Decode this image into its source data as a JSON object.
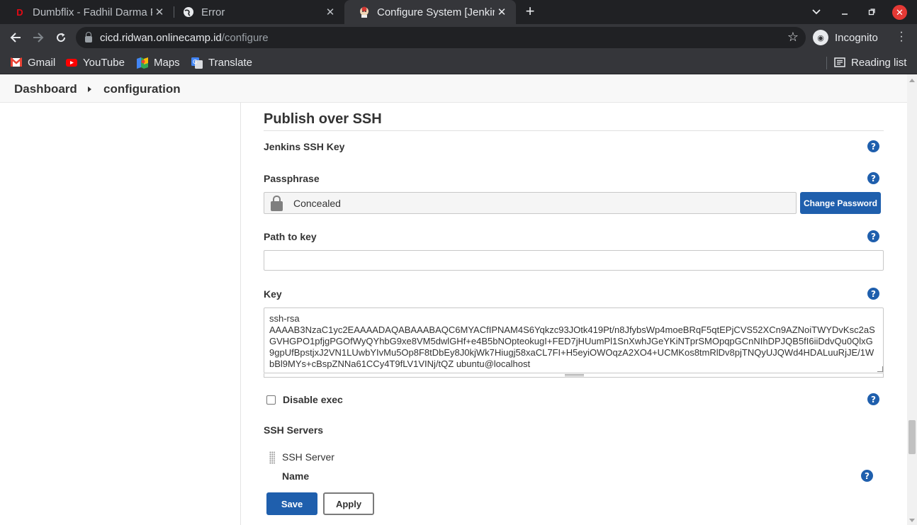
{
  "browser": {
    "tabs": [
      {
        "title": "Dumbflix - Fadhil Darma P",
        "icon": "dumbflix-icon",
        "active": false
      },
      {
        "title": "Error",
        "icon": "globe-icon",
        "active": false
      },
      {
        "title": "Configure System [Jenkins",
        "icon": "jenkins-icon",
        "active": true
      }
    ],
    "new_tab": "+",
    "url_host": "cicd.ridwan.onlinecamp.id",
    "url_path": "/configure",
    "profile_label": "Incognito",
    "bookmarks": [
      {
        "label": "Gmail",
        "icon": "gmail-icon",
        "color": "#ea4335"
      },
      {
        "label": "YouTube",
        "icon": "youtube-icon",
        "color": "#ff0000"
      },
      {
        "label": "Maps",
        "icon": "maps-icon",
        "color": "#34a853"
      },
      {
        "label": "Translate",
        "icon": "translate-icon",
        "color": "#4285f4"
      }
    ],
    "reading_list": "Reading list"
  },
  "breadcrumb": {
    "items": [
      "Dashboard",
      "configuration"
    ]
  },
  "section": {
    "title": "Publish over SSH",
    "jenkins_ssh_key_label": "Jenkins SSH Key",
    "passphrase_label": "Passphrase",
    "passphrase_value": "Concealed",
    "change_password_label": "Change Password",
    "path_to_key_label": "Path to key",
    "path_to_key_value": "",
    "key_label": "Key",
    "key_line1": "ssh-rsa",
    "key_line2": "AAAAB3NzaC1yc2EAAAADAQABAAABAQC6MYACfIPNAM4S6Yqkzc93JOtk419Pt/n8JfybsWp4moeBRqF5qtEPjCVS52XCn9AZNoiTWYDvKsc2aSGVHGPO1pfjgPGOfWyQYhbG9xe8VM5dwlGHf+e4B5bNOpteokugI+FED7jHUumPl1SnXwhJGeYKiNTprSMOpqpGCnNIhDPJQB5fI6iiDdvQu0QlxG9gpUfBpstjxJ2VN1LUwbYIvMu5Op8F8tDbEy8J0kjWk7Hiugj58xaCL7FI+H5eyiOWOqzA2XO4+UCMKos8tmRlDv8pjTNQyUJQWd4HDALuuRjJE/1WbBl9MYs+cBspZNNa61CCy4T9fLV1VINj/tQZ ubuntu@localhost",
    "disable_exec_label": "Disable exec",
    "ssh_servers_label": "SSH Servers",
    "ssh_server_label": "SSH Server",
    "name_label": "Name",
    "help_glyph": "?"
  },
  "actions": {
    "save_label": "Save",
    "apply_label": "Apply"
  },
  "colors": {
    "primary": "#1f5fad",
    "chrome_dark": "#202124",
    "chrome_toolbar": "#35363a"
  }
}
